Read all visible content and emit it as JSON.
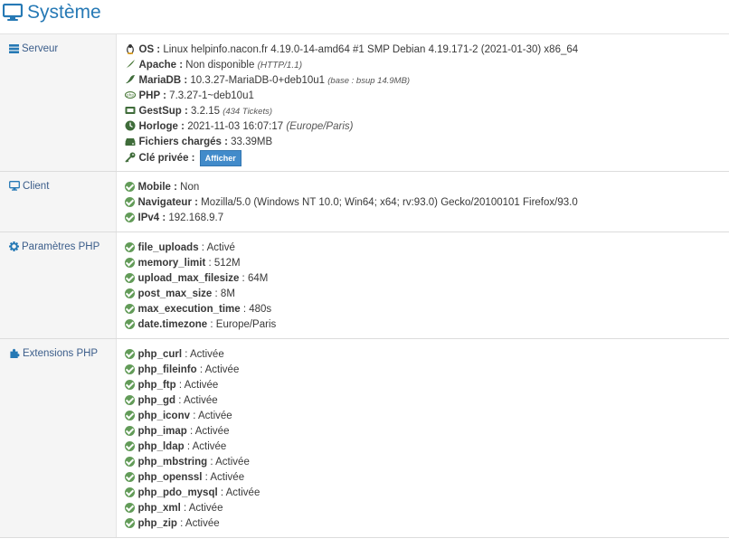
{
  "header": {
    "title": "Système",
    "icon": "monitor-icon",
    "color": "#2679b5"
  },
  "server": {
    "label": "Serveur",
    "os_label": "OS :",
    "os_value": "Linux helpinfo.nacon.fr 4.19.0-14-amd64 #1 SMP Debian 4.19.171-2 (2021-01-30) x86_64",
    "apache_label": "Apache :",
    "apache_value": "Non disponible",
    "apache_note": "(HTTP/1.1)",
    "mariadb_label": "MariaDB :",
    "mariadb_value": "10.3.27-MariaDB-0+deb10u1",
    "mariadb_note": "(base : bsup 14.9MB)",
    "php_label": "PHP :",
    "php_value": "7.3.27-1~deb10u1",
    "gestsup_label": "GestSup :",
    "gestsup_value": "3.2.15",
    "gestsup_note": "(434 Tickets)",
    "clock_label": "Horloge :",
    "clock_value": "2021-11-03 16:07:17",
    "clock_note": "(Europe/Paris)",
    "files_label": "Fichiers chargés :",
    "files_value": "33.39MB",
    "key_label": "Clé privée :",
    "key_button": "Afficher"
  },
  "client": {
    "label": "Client",
    "mobile_label": "Mobile :",
    "mobile_value": "Non",
    "browser_label": "Navigateur :",
    "browser_value": "Mozilla/5.0 (Windows NT 10.0; Win64; x64; rv:93.0) Gecko/20100101 Firefox/93.0",
    "ipv4_label": "IPv4 :",
    "ipv4_value": "192.168.9.7"
  },
  "php_params": {
    "label": "Paramètres PHP",
    "items": [
      {
        "key": "file_uploads",
        "sep": " : ",
        "value": "Activé"
      },
      {
        "key": "memory_limit",
        "sep": " : ",
        "value": "512M"
      },
      {
        "key": "upload_max_filesize",
        "sep": " : ",
        "value": "64M"
      },
      {
        "key": "post_max_size",
        "sep": " : ",
        "value": "8M"
      },
      {
        "key": "max_execution_time",
        "sep": " : ",
        "value": "480s"
      },
      {
        "key": "date.timezone",
        "sep": " : ",
        "value": "Europe/Paris"
      }
    ]
  },
  "php_ext": {
    "label": "Extensions PHP",
    "items": [
      {
        "key": "php_curl",
        "sep": " : ",
        "value": "Activée"
      },
      {
        "key": "php_fileinfo",
        "sep": " : ",
        "value": "Activée"
      },
      {
        "key": "php_ftp",
        "sep": " : ",
        "value": "Activée"
      },
      {
        "key": "php_gd",
        "sep": " : ",
        "value": "Activée"
      },
      {
        "key": "php_iconv",
        "sep": " : ",
        "value": "Activée"
      },
      {
        "key": "php_imap",
        "sep": " : ",
        "value": "Activée"
      },
      {
        "key": "php_ldap",
        "sep": " : ",
        "value": "Activée"
      },
      {
        "key": "php_mbstring",
        "sep": " : ",
        "value": "Activée"
      },
      {
        "key": "php_openssl",
        "sep": " : ",
        "value": "Activée"
      },
      {
        "key": "php_pdo_mysql",
        "sep": " : ",
        "value": "Activée"
      },
      {
        "key": "php_xml",
        "sep": " : ",
        "value": "Activée"
      },
      {
        "key": "php_zip",
        "sep": " : ",
        "value": "Activée"
      }
    ]
  },
  "colors": {
    "ok": "#629b58",
    "button": "#428bca",
    "label": "#3b5d8a"
  }
}
